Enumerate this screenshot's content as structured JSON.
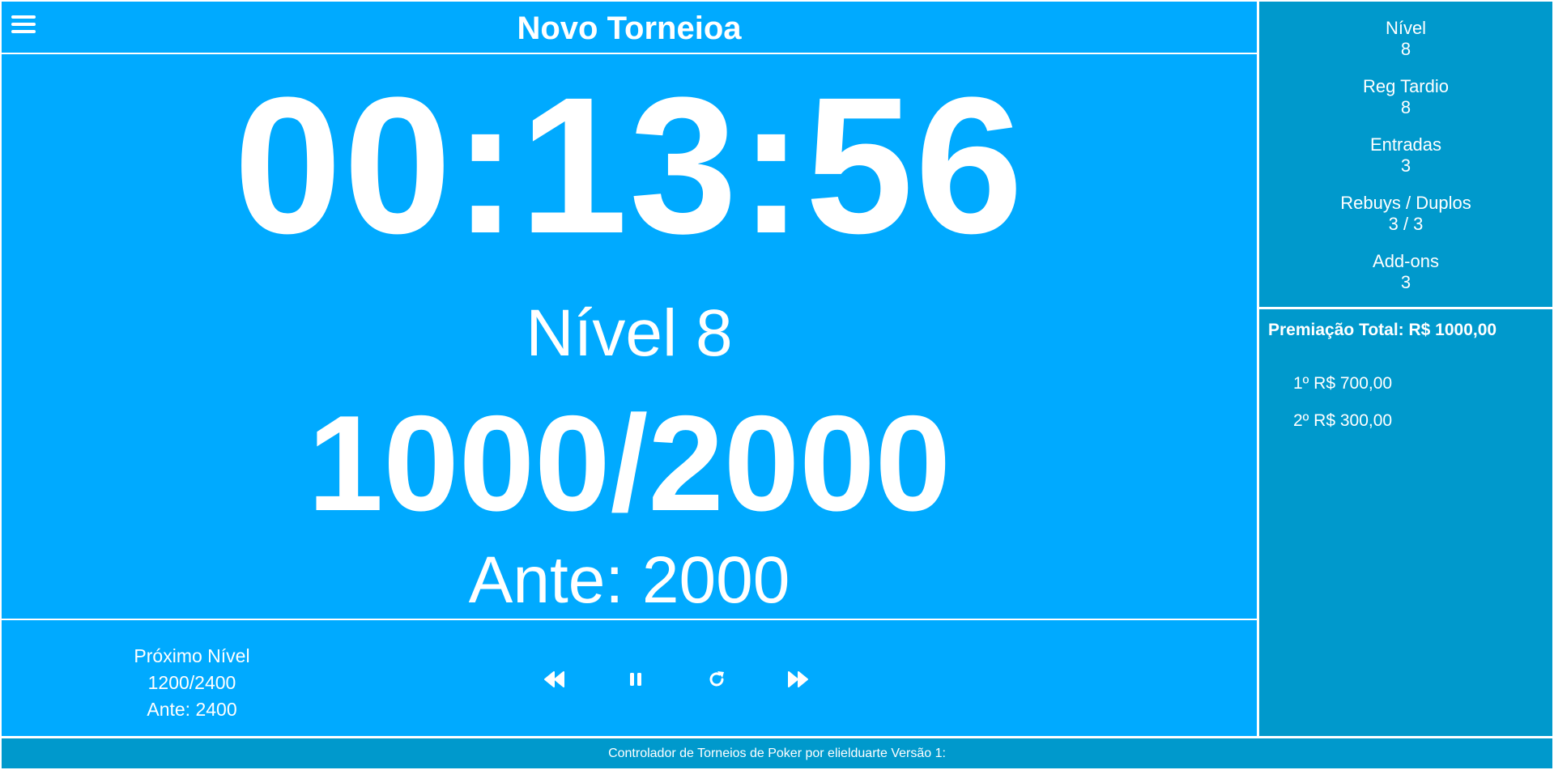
{
  "header": {
    "title": "Novo Torneioa"
  },
  "timer": {
    "clock": "00:13:56",
    "level_label": "Nível 8",
    "blinds": "1000/2000",
    "ante": "Ante: 2000"
  },
  "next_level": {
    "heading": "Próximo Nível",
    "blinds": "1200/2400",
    "ante": "Ante: 2400"
  },
  "controls": [
    {
      "icon": "rewind-icon"
    },
    {
      "icon": "pause-icon"
    },
    {
      "icon": "restart-icon"
    },
    {
      "icon": "fast-forward-icon"
    }
  ],
  "stats": {
    "level": {
      "label": "Nível",
      "value": "8"
    },
    "late_reg": {
      "label": "Reg Tardio",
      "value": "8"
    },
    "entries": {
      "label": "Entradas",
      "value": "3"
    },
    "rebuys": {
      "label": "Rebuys / Duplos",
      "value": "3 / 3"
    },
    "addons": {
      "label": "Add-ons",
      "value": "3"
    }
  },
  "prizes": {
    "total": "Premiação Total: R$ 1000,00",
    "places": [
      "1º R$ 700,00",
      "2º R$ 300,00"
    ]
  },
  "footer": {
    "text": "Controlador de Torneios de Poker por elielduarte Versão 1:"
  },
  "colors": {
    "main_bg": "#00aaff",
    "sidebar_bg": "#0099cc",
    "text": "#ffffff"
  }
}
